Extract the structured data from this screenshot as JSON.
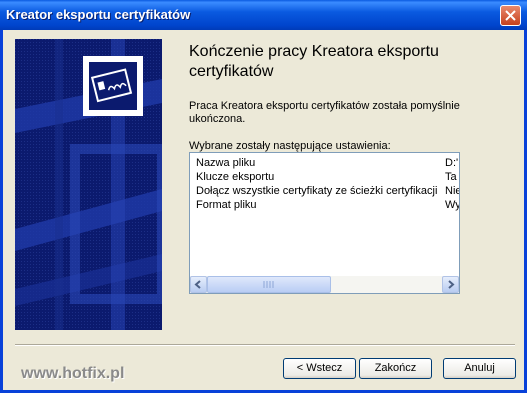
{
  "window": {
    "title": "Kreator eksportu certyfikatów"
  },
  "heading": "Kończenie pracy Kreatora eksportu certyfikatów",
  "description": "Praca Kreatora eksportu certyfikatów została pomyślnie ukończona.",
  "settings_label": "Wybrane zostały następujące ustawienia:",
  "settings": [
    {
      "name": "Nazwa pliku",
      "value": "D:'"
    },
    {
      "name": "Klucze eksportu",
      "value": "Ta"
    },
    {
      "name": "Dołącz wszystkie certyfikaty ze ścieżki certyfikacji",
      "value": "Nie"
    },
    {
      "name": "Format pliku",
      "value": "Wy"
    }
  ],
  "buttons": {
    "back": "< Wstecz",
    "finish": "Zakończ",
    "cancel": "Anuluj"
  },
  "watermark": "www.hotfix.pl",
  "colors": {
    "titlebar": "#0a5ae0",
    "sidebar": "#0b1a6e",
    "close": "#c6411d"
  }
}
